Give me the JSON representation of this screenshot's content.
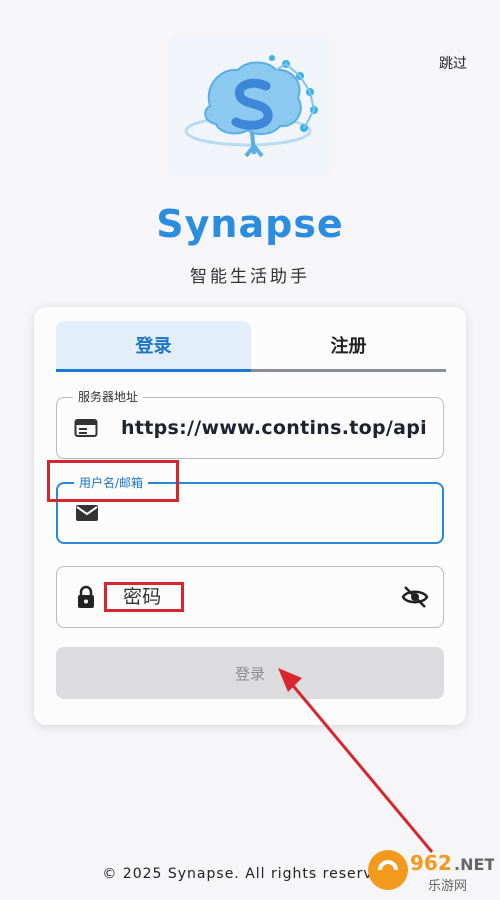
{
  "header": {
    "skip_label": "跳过"
  },
  "brand": {
    "logo_icon": "brain-s-logo",
    "name": "Synapse",
    "subtitle": "智能生活助手",
    "color": "#2a8de0"
  },
  "tabs": [
    {
      "label": "登录",
      "active": true
    },
    {
      "label": "注册",
      "active": false
    }
  ],
  "form": {
    "server": {
      "label": "服务器地址",
      "value": "https://www.contins.top/api",
      "icon": "server-icon"
    },
    "username": {
      "label": "用户名/邮箱",
      "value": "",
      "icon": "mail-icon"
    },
    "password": {
      "placeholder": "密码",
      "value": "",
      "icon": "lock-icon",
      "toggle_icon": "eye-off-icon"
    },
    "submit_label": "登录"
  },
  "footer": {
    "text": "© 2025 Synapse. All rights reserved."
  },
  "watermark": {
    "brand": "962.NET",
    "subtitle": "乐游网"
  },
  "colors": {
    "accent": "#2a8de0",
    "annotation": "#d7262d"
  }
}
